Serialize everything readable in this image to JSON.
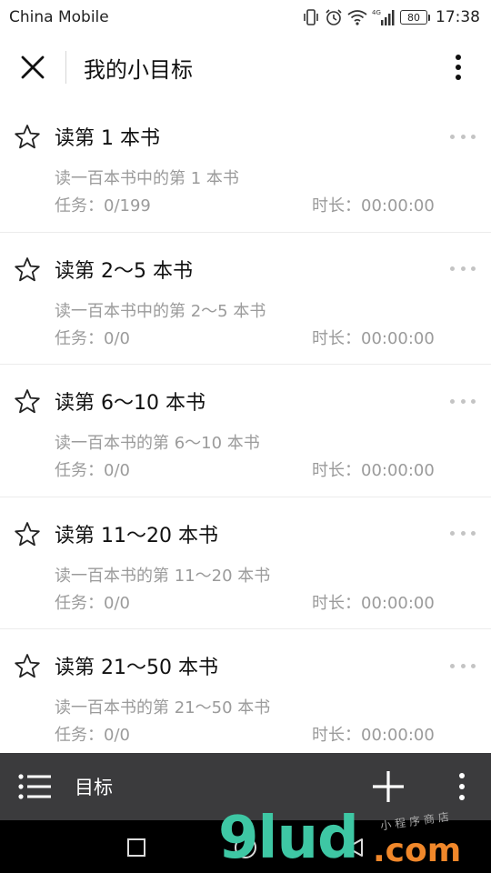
{
  "status_bar": {
    "carrier": "China Mobile",
    "battery": "80",
    "network": "4G",
    "time": "17:38"
  },
  "header": {
    "title": "我的小目标",
    "close_icon": "close-icon",
    "more_icon": "more-vertical-icon"
  },
  "goals": [
    {
      "title": "读第 1 本书",
      "description": "读一百本书中的第 1 本书",
      "task": "任务：0/199",
      "duration": "时长：00:00:00"
    },
    {
      "title": "读第 2～5 本书",
      "description": "读一百本书中的第 2～5 本书",
      "task": "任务：0/0",
      "duration": "时长：00:00:00"
    },
    {
      "title": "读第 6～10 本书",
      "description": "读一百本书的第 6～10 本书",
      "task": "任务：0/0",
      "duration": "时长：00:00:00"
    },
    {
      "title": "读第 11～20 本书",
      "description": "读一百本书的第 11～20 本书",
      "task": "任务：0/0",
      "duration": "时长：00:00:00"
    },
    {
      "title": "读第 21～50 本书",
      "description": "读一百本书的第 21～50 本书",
      "task": "任务：0/0",
      "duration": "时长：00:00:00"
    }
  ],
  "bottom_bar": {
    "label": "目标",
    "list_icon": "list-icon",
    "add_icon": "plus-icon",
    "more_icon": "more-vertical-icon"
  },
  "watermark": {
    "main": "9lud",
    "suffix": ".com",
    "sub": "小程序商店"
  },
  "colors": {
    "bottom_bar_bg": "#3b3b3d",
    "secondary_text": "#9b9b9b",
    "watermark_green": "#3ec7a4",
    "watermark_orange": "#f0872a"
  }
}
